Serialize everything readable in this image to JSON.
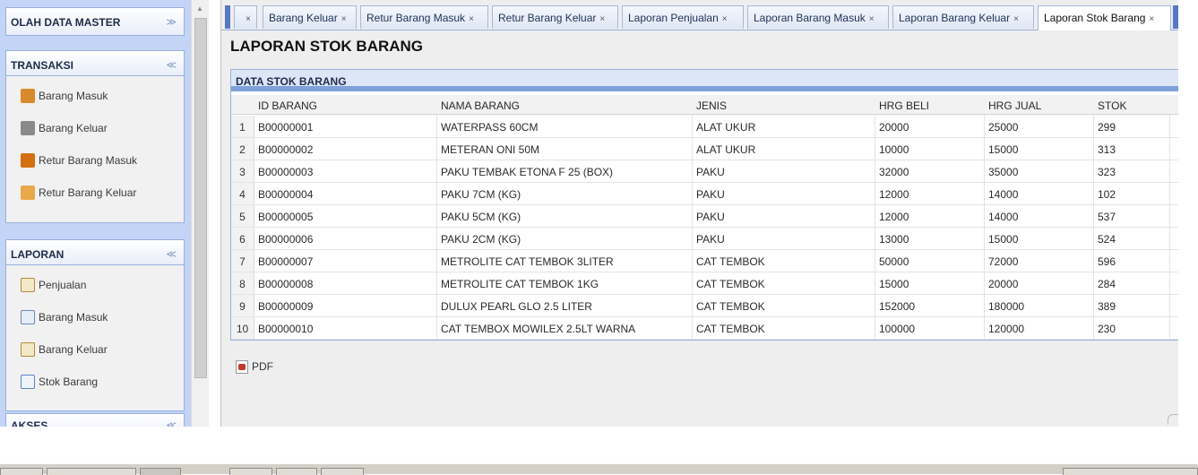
{
  "sidebar": {
    "panels": [
      {
        "title": "OLAH DATA MASTER",
        "toggle": "»"
      },
      {
        "title": "TRANSAKSI",
        "toggle": "«",
        "items": [
          {
            "label": "Barang Masuk",
            "icon": "truck-icon"
          },
          {
            "label": "Barang Keluar",
            "icon": "truck-out-icon"
          },
          {
            "label": "Retur Barang Masuk",
            "icon": "box-return-icon"
          },
          {
            "label": "Retur Barang Keluar",
            "icon": "box-send-icon"
          }
        ]
      },
      {
        "title": "LAPORAN",
        "toggle": "«",
        "items": [
          {
            "label": "Penjualan",
            "icon": "report-icon"
          },
          {
            "label": "Barang Masuk",
            "icon": "report-icon"
          },
          {
            "label": "Barang Keluar",
            "icon": "report-icon"
          },
          {
            "label": "Stok Barang",
            "icon": "stock-report-icon"
          }
        ]
      },
      {
        "title": "AKSES",
        "toggle": "«"
      }
    ]
  },
  "tabs": {
    "close_glyph": "×",
    "items": [
      {
        "label": ""
      },
      {
        "label": "Barang Keluar"
      },
      {
        "label": "Retur Barang Masuk"
      },
      {
        "label": "Retur Barang Keluar"
      },
      {
        "label": "Laporan Penjualan"
      },
      {
        "label": "Laporan Barang Masuk"
      },
      {
        "label": "Laporan Barang Keluar"
      },
      {
        "label": "Laporan Stok Barang",
        "active": true
      }
    ]
  },
  "page_title": "LAPORAN STOK BARANG",
  "grid": {
    "title": "DATA STOK BARANG",
    "columns": [
      "ID BARANG",
      "NAMA BARANG",
      "JENIS",
      "HRG BELI",
      "HRG JUAL",
      "STOK"
    ],
    "rows": [
      {
        "no": "1",
        "id": "B00000001",
        "nama": "WATERPASS 60CM",
        "jenis": "ALAT UKUR",
        "beli": "20000",
        "jual": "25000",
        "stok": "299"
      },
      {
        "no": "2",
        "id": "B00000002",
        "nama": "METERAN ONI 50M",
        "jenis": "ALAT UKUR",
        "beli": "10000",
        "jual": "15000",
        "stok": "313"
      },
      {
        "no": "3",
        "id": "B00000003",
        "nama": "PAKU TEMBAK ETONA F 25 (BOX)",
        "jenis": "PAKU",
        "beli": "32000",
        "jual": "35000",
        "stok": "323"
      },
      {
        "no": "4",
        "id": "B00000004",
        "nama": "PAKU 7CM (KG)",
        "jenis": "PAKU",
        "beli": "12000",
        "jual": "14000",
        "stok": "102"
      },
      {
        "no": "5",
        "id": "B00000005",
        "nama": "PAKU 5CM (KG)",
        "jenis": "PAKU",
        "beli": "12000",
        "jual": "14000",
        "stok": "537"
      },
      {
        "no": "6",
        "id": "B00000006",
        "nama": "PAKU 2CM (KG)",
        "jenis": "PAKU",
        "beli": "13000",
        "jual": "15000",
        "stok": "524"
      },
      {
        "no": "7",
        "id": "B00000007",
        "nama": "METROLITE CAT TEMBOK 3LITER",
        "jenis": "CAT TEMBOK",
        "beli": "50000",
        "jual": "72000",
        "stok": "596"
      },
      {
        "no": "8",
        "id": "B00000008",
        "nama": "METROLITE CAT TEMBOK 1KG",
        "jenis": "CAT TEMBOK",
        "beli": "15000",
        "jual": "20000",
        "stok": "284"
      },
      {
        "no": "9",
        "id": "B00000009",
        "nama": "DULUX PEARL GLO 2.5 LITER",
        "jenis": "CAT TEMBOK",
        "beli": "152000",
        "jual": "180000",
        "stok": "389"
      },
      {
        "no": "10",
        "id": "B00000010",
        "nama": "CAT TEMBOX MOWILEX 2.5LT WARNA",
        "jenis": "CAT TEMBOK",
        "beli": "100000",
        "jual": "120000",
        "stok": "230"
      }
    ]
  },
  "export": {
    "pdf_label": "PDF",
    "icon": "pdf-icon"
  },
  "colors": {
    "accent": "#7fa0da",
    "sidebar_bg": "#c3d4f7",
    "panel_border": "#99b0dd"
  }
}
